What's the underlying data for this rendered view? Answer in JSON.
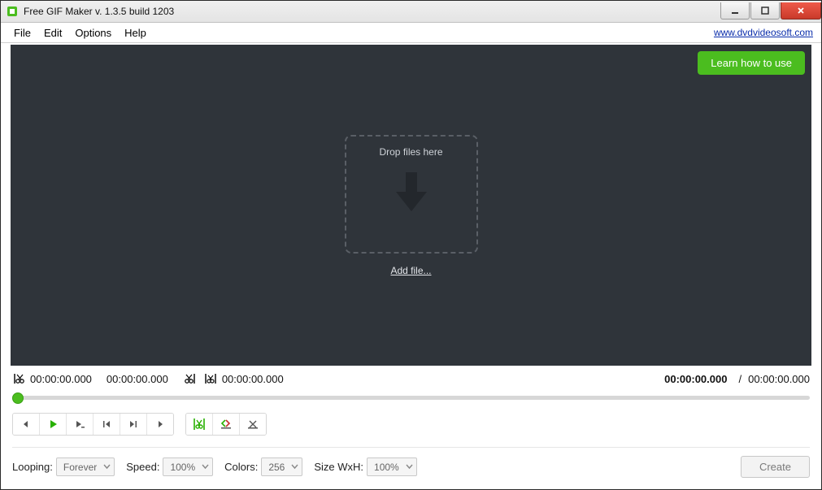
{
  "titlebar": {
    "title": "Free GIF Maker v. 1.3.5 build 1203"
  },
  "menubar": {
    "file": "File",
    "edit": "Edit",
    "options": "Options",
    "help": "Help",
    "site_link": "www.dvdvideosoft.com"
  },
  "preview": {
    "learn_button": "Learn how to use",
    "drop_label": "Drop files here",
    "add_file": "Add file..."
  },
  "timeline": {
    "trim_start": "00:00:00.000",
    "trim_end": "00:00:00.000",
    "clip_duration": "00:00:00.000",
    "current": "00:00:00.000",
    "total": "00:00:00.000",
    "separator": "/"
  },
  "options": {
    "looping_label": "Looping:",
    "looping_value": "Forever",
    "speed_label": "Speed:",
    "speed_value": "100%",
    "colors_label": "Colors:",
    "colors_value": "256",
    "size_label": "Size WxH:",
    "size_value": "100%",
    "create_button": "Create"
  }
}
